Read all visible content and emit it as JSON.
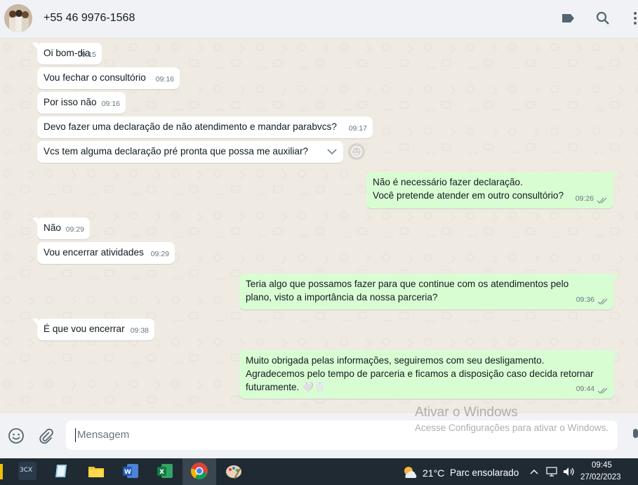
{
  "header": {
    "contact": "+55 46 9976-1568"
  },
  "messages": [
    {
      "dir": "in",
      "text": "Oi bom-dia",
      "time": "09:15"
    },
    {
      "dir": "in",
      "text": "Vou fechar o consultório",
      "time": "09:16"
    },
    {
      "dir": "in",
      "text": "Por isso não",
      "time": "09:16"
    },
    {
      "dir": "in",
      "text": "Devo fazer uma declaração de não atendimento e mandar parabvcs?",
      "time": "09:17"
    },
    {
      "dir": "in",
      "text": "Vcs tem alguma declaração pré pronta que possa me auxiliar?",
      "time": ""
    },
    {
      "dir": "out",
      "text": "Não é necessário fazer declaração.\nVocê pretende atender em outro consultório?",
      "time": "09:26"
    },
    {
      "dir": "in",
      "text": "Não",
      "time": "09:29"
    },
    {
      "dir": "in",
      "text": "Vou encerrar atividades",
      "time": "09:29"
    },
    {
      "dir": "out",
      "text": "Teria algo que possamos fazer para que continue com os atendimentos pelo\nplano, visto a importância da nossa parceria?",
      "time": "09:36"
    },
    {
      "dir": "in",
      "text": "É que vou encerrar",
      "time": "09:38"
    },
    {
      "dir": "out",
      "text": "Muito obrigada pelas informações, seguiremos com seu desligamento.\nAgradecemos pelo tempo de parceria e ficamos a disposição caso decida retornar\nfuturamente. 🤍🦷",
      "time": "09:44"
    }
  ],
  "composer": {
    "placeholder": "Mensagem"
  },
  "watermark": {
    "title": "Ativar o Windows",
    "subtitle": "Acesse Configurações para ativar o Windows."
  },
  "taskbar": {
    "weather_temp": "21°C",
    "weather_text": "Parc ensolarado",
    "time": "09:45",
    "date": "27/02/2023",
    "app_3cx": "3CX"
  },
  "colors": {
    "incoming": "#ffffff",
    "outgoing": "#d9fdd3",
    "chat_bg": "#efeae2"
  }
}
